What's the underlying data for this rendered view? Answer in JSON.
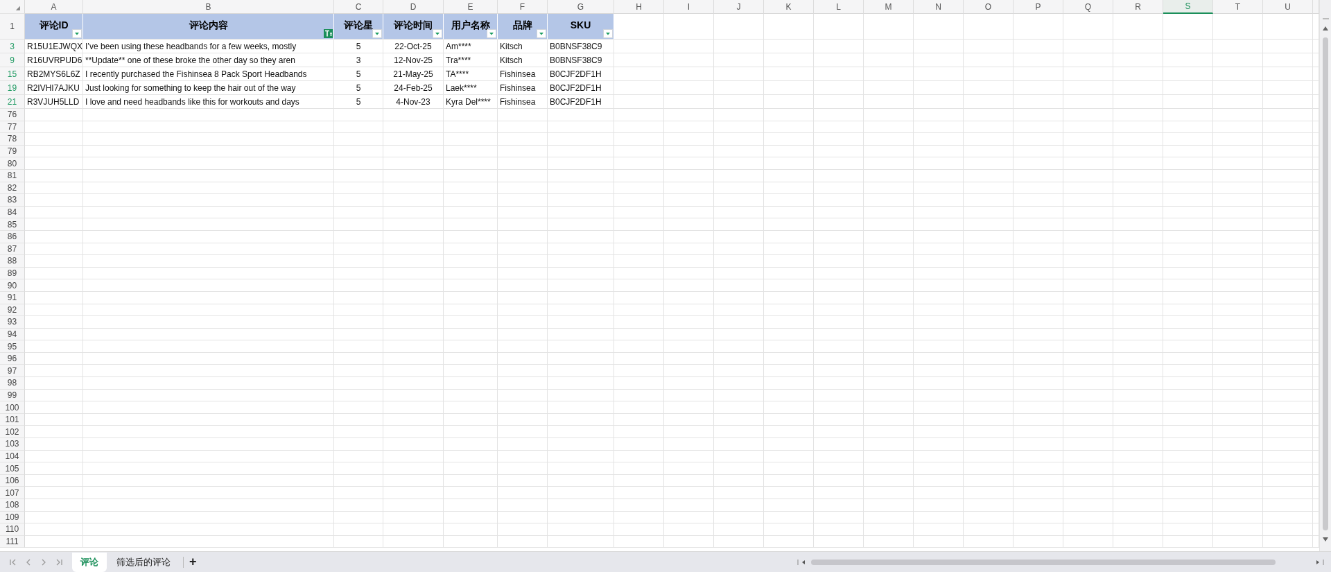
{
  "sheet": {
    "corner": "◢",
    "column_headers": [
      {
        "label": "A",
        "selected": false
      },
      {
        "label": "B",
        "selected": false
      },
      {
        "label": "C",
        "selected": false
      },
      {
        "label": "D",
        "selected": false
      },
      {
        "label": "E",
        "selected": false
      },
      {
        "label": "F",
        "selected": false
      },
      {
        "label": "G",
        "selected": false
      },
      {
        "label": "H",
        "selected": false
      },
      {
        "label": "I",
        "selected": false
      },
      {
        "label": "J",
        "selected": false
      },
      {
        "label": "K",
        "selected": false
      },
      {
        "label": "L",
        "selected": false
      },
      {
        "label": "M",
        "selected": false
      },
      {
        "label": "N",
        "selected": false
      },
      {
        "label": "O",
        "selected": false
      },
      {
        "label": "P",
        "selected": false
      },
      {
        "label": "Q",
        "selected": false
      },
      {
        "label": "R",
        "selected": false
      },
      {
        "label": "S",
        "selected": true
      },
      {
        "label": "T",
        "selected": false
      },
      {
        "label": "U",
        "selected": false
      }
    ],
    "header_row": {
      "number": "1",
      "cells": [
        {
          "text": "评论ID",
          "filtered": false
        },
        {
          "text": "评论内容",
          "filtered": true
        },
        {
          "text": "评论星",
          "filtered": false
        },
        {
          "text": "评论时间",
          "filtered": false
        },
        {
          "text": "用户名称",
          "filtered": false
        },
        {
          "text": "品牌",
          "filtered": false
        },
        {
          "text": "SKU",
          "filtered": false
        }
      ]
    },
    "rows": [
      {
        "number": "3",
        "filtered": true,
        "cells": [
          "R15U1EJWQX",
          "I’ve been using these headbands for a few weeks, mostly",
          "5",
          "22-Oct-25",
          "Am****",
          "Kitsch",
          "B0BNSF38C9"
        ]
      },
      {
        "number": "9",
        "filtered": true,
        "cells": [
          "R16UVRPUD6",
          "**Update** one of these broke the other day so they aren",
          "3",
          "12-Nov-25",
          "Tra****",
          "Kitsch",
          "B0BNSF38C9"
        ]
      },
      {
        "number": "15",
        "filtered": true,
        "cells": [
          "RB2MYS6L6Z",
          "I recently purchased the Fishinsea 8 Pack Sport Headbands",
          "5",
          "21-May-25",
          "TA****",
          "Fishinsea",
          "B0CJF2DF1H"
        ]
      },
      {
        "number": "19",
        "filtered": true,
        "cells": [
          "R2IVHI7AJKU",
          "Just looking for something to keep the hair out of the way",
          "5",
          "24-Feb-25",
          "Laek****",
          "Fishinsea",
          "B0CJF2DF1H"
        ]
      },
      {
        "number": "21",
        "filtered": true,
        "cells": [
          "R3VJUH5LLD",
          "I love and need headbands like this for workouts and days",
          "5",
          "4-Nov-23",
          "Kyra Del****",
          "Fishinsea",
          "B0CJF2DF1H"
        ]
      },
      {
        "number": "76",
        "filtered": false
      },
      {
        "number": "77",
        "filtered": false
      },
      {
        "number": "78",
        "filtered": false
      },
      {
        "number": "79",
        "filtered": false
      },
      {
        "number": "80",
        "filtered": false
      },
      {
        "number": "81",
        "filtered": false
      },
      {
        "number": "82",
        "filtered": false
      },
      {
        "number": "83",
        "filtered": false
      },
      {
        "number": "84",
        "filtered": false
      },
      {
        "number": "85",
        "filtered": false
      },
      {
        "number": "86",
        "filtered": false
      },
      {
        "number": "87",
        "filtered": false
      },
      {
        "number": "88",
        "filtered": false
      },
      {
        "number": "89",
        "filtered": false
      },
      {
        "number": "90",
        "filtered": false
      },
      {
        "number": "91",
        "filtered": false
      },
      {
        "number": "92",
        "filtered": false
      },
      {
        "number": "93",
        "filtered": false
      },
      {
        "number": "94",
        "filtered": false
      },
      {
        "number": "95",
        "filtered": false
      },
      {
        "number": "96",
        "filtered": false
      },
      {
        "number": "97",
        "filtered": false
      },
      {
        "number": "98",
        "filtered": false
      },
      {
        "number": "99",
        "filtered": false
      },
      {
        "number": "100",
        "filtered": false
      },
      {
        "number": "101",
        "filtered": false
      },
      {
        "number": "102",
        "filtered": false
      },
      {
        "number": "103",
        "filtered": false
      },
      {
        "number": "104",
        "filtered": false
      },
      {
        "number": "105",
        "filtered": false
      },
      {
        "number": "106",
        "filtered": false
      },
      {
        "number": "107",
        "filtered": false
      },
      {
        "number": "108",
        "filtered": false
      },
      {
        "number": "109",
        "filtered": false
      },
      {
        "number": "110",
        "filtered": false
      },
      {
        "number": "111",
        "filtered": false
      }
    ]
  },
  "sheet_tabs": [
    {
      "label": "评论",
      "selected": true
    },
    {
      "label": "筛选后的评论",
      "selected": false
    }
  ],
  "add_sheet": "+"
}
